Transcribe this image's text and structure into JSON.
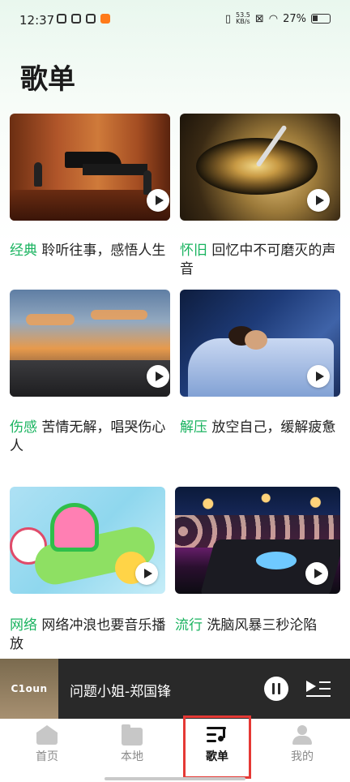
{
  "status_bar": {
    "time": "12:37",
    "net_speed_top": "53.5",
    "net_speed_unit": "KB/s",
    "battery": "27%"
  },
  "page": {
    "title": "歌单"
  },
  "playlists": [
    {
      "tag": "经典",
      "text": "聆听往事，感悟人生",
      "image": "concert-piano-photo"
    },
    {
      "tag": "怀旧",
      "text": "回忆中不可磨灭的声音",
      "image": "vinyl-record-photo"
    },
    {
      "tag": "伤感",
      "text": "苦情无解，唱哭伤心人",
      "image": "harbor-sunset-photo"
    },
    {
      "tag": "解压",
      "text": "放空自己，缓解疲惫",
      "image": "sleeping-woman-photo"
    },
    {
      "tag": "网络",
      "text": "网络冲浪也要音乐播放",
      "image": "cartoon-toys-image"
    },
    {
      "tag": "流行",
      "text": "洗脑风暴三秒沦陷",
      "image": "dj-concert-photo"
    }
  ],
  "player": {
    "cover_text": "C1oun",
    "song": "问题小姐-郑国锋"
  },
  "bottom_nav": [
    {
      "label": "首页",
      "icon": "home-icon",
      "active": false
    },
    {
      "label": "本地",
      "icon": "folder-icon",
      "active": false
    },
    {
      "label": "歌单",
      "icon": "playlist-icon",
      "active": true
    },
    {
      "label": "我的",
      "icon": "user-icon",
      "active": false
    }
  ],
  "colors": {
    "accent": "#19b35f",
    "player_bg": "#292929",
    "highlight": "#e53935"
  }
}
